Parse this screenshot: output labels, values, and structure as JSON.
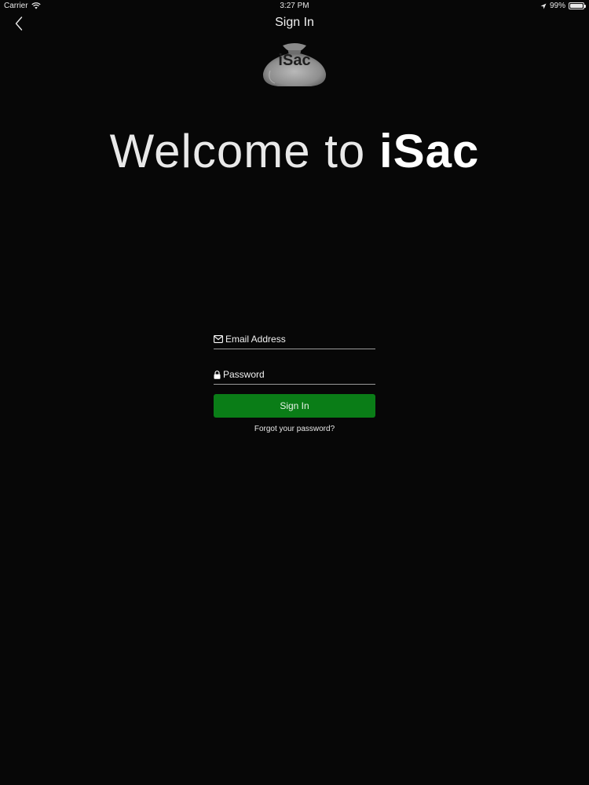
{
  "status_bar": {
    "carrier": "Carrier",
    "time": "3:27 PM",
    "battery": "99%",
    "battery_level": 0.99,
    "icons": [
      "wifi-icon",
      "location-arrow-icon",
      "battery-icon"
    ]
  },
  "nav": {
    "title": "Sign In",
    "back_icon": "chevron-left-icon"
  },
  "logo": {
    "text": "iSac",
    "icon": "money-bag-icon"
  },
  "welcome": {
    "prefix": "Welcome to ",
    "brand": "iSac"
  },
  "form": {
    "email_placeholder": "Email Address",
    "email_icon": "envelope-icon",
    "password_placeholder": "Password",
    "password_icon": "lock-icon",
    "signin_label": "Sign In",
    "forgot_label": "Forgot your password?"
  },
  "colors": {
    "background": "#070707",
    "accent_green": "#0a7d17",
    "text": "#ffffff"
  }
}
